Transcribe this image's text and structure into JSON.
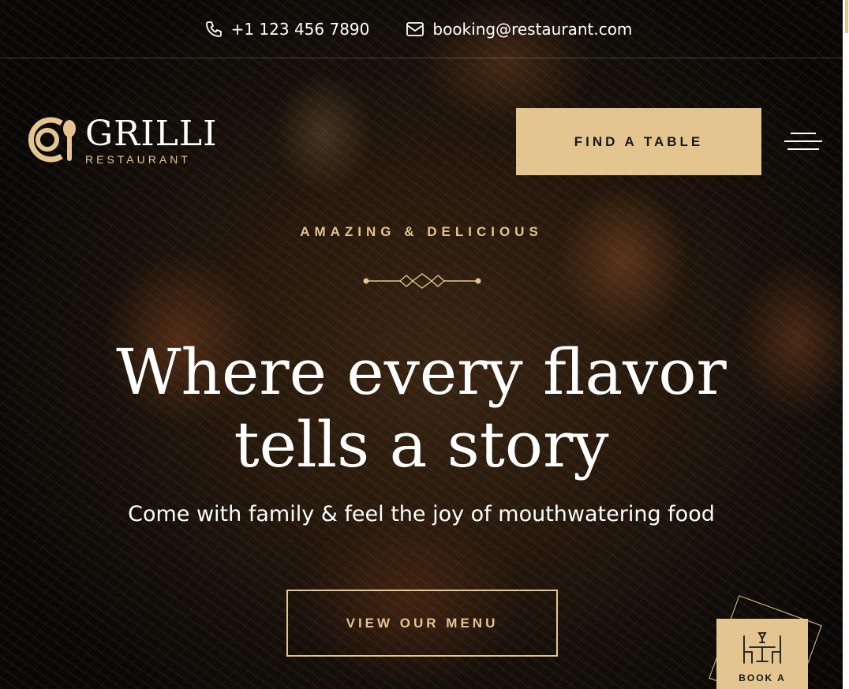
{
  "colors": {
    "accent": "#e4c590",
    "text": "#ffffff",
    "button_text": "#161718"
  },
  "topbar": {
    "phone": "+1 123 456 7890",
    "email": "booking@restaurant.com",
    "phone_icon": "phone-icon",
    "email_icon": "mail-icon"
  },
  "logo": {
    "name": "GRILLI",
    "tagline": "RESTAURANT",
    "icon": "plate-spoon-icon"
  },
  "header": {
    "cta_label": "FIND A TABLE",
    "menu_icon": "hamburger-icon"
  },
  "hero": {
    "eyebrow": "AMAZING & DELICIOUS",
    "title_line1": "Where every flavor",
    "title_line2": "tells a story",
    "subtitle": "Come with family & feel the joy of mouthwatering food",
    "button_label": "VIEW OUR MENU"
  },
  "book_badge": {
    "label": "BOOK A",
    "icon": "dining-table-icon"
  }
}
